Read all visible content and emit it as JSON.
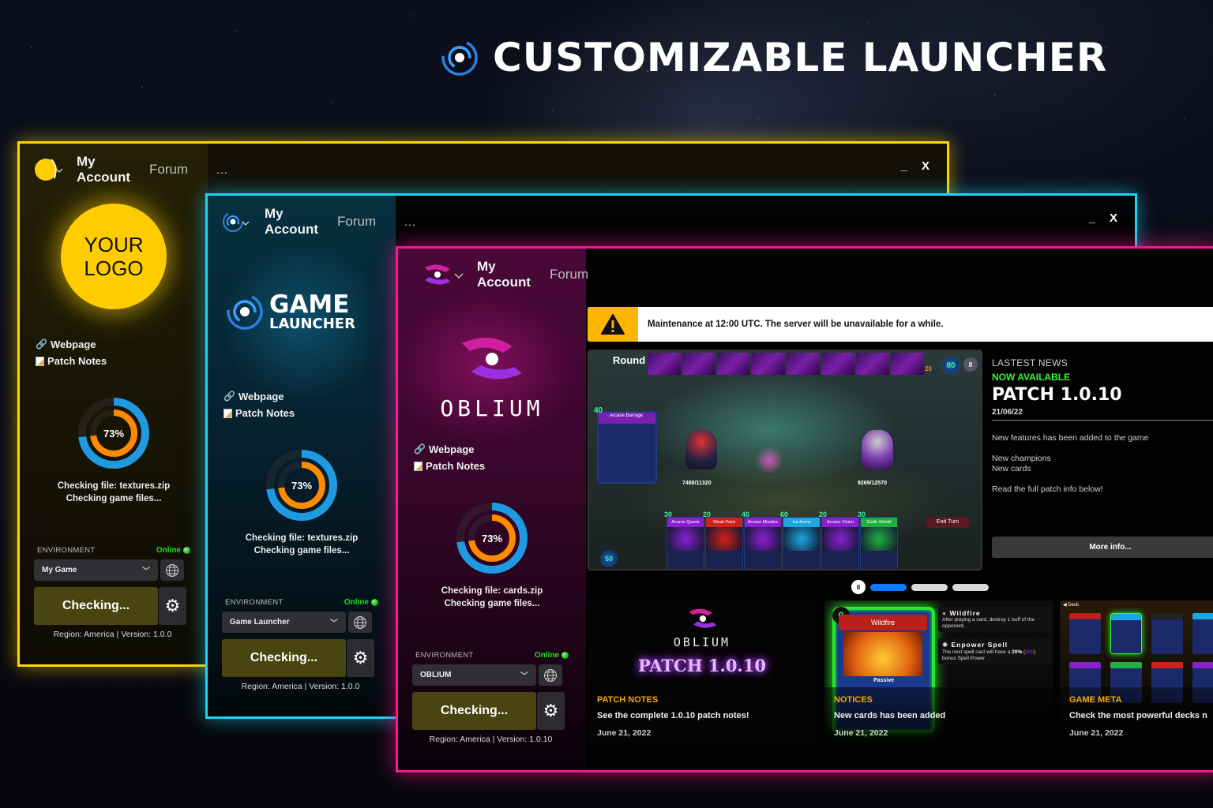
{
  "headline": {
    "title": "CUSTOMIZABLE LAUNCHER",
    "icon": "launcher-ring-icon"
  },
  "windows": [
    {
      "theme": "yellow",
      "accent": "#ffd400",
      "nav": {
        "account": "My Account",
        "forum": "Forum",
        "more": "..."
      },
      "controls": {
        "minimize": "_",
        "close": "X"
      },
      "brand": {
        "line1": "YOUR",
        "line2": "LOGO"
      },
      "links": {
        "webpage": "Webpage",
        "patch_notes": "Patch Notes"
      },
      "progress": {
        "percent": 73,
        "label": "73%"
      },
      "status": {
        "file": "Checking file: textures.zip",
        "action": "Checking game files..."
      },
      "environment": {
        "label": "ENVIRONMENT",
        "status": "Online",
        "selected": "My Game"
      },
      "action_button": "Checking...",
      "footer": "Region: America | Version: 1.0.0"
    },
    {
      "theme": "blue",
      "accent": "#1ed4f5",
      "nav": {
        "account": "My Account",
        "forum": "Forum",
        "more": "..."
      },
      "controls": {
        "minimize": "_",
        "close": "X"
      },
      "brand": {
        "line1": "GAME",
        "line2": "LAUNCHER"
      },
      "links": {
        "webpage": "Webpage",
        "patch_notes": "Patch Notes"
      },
      "progress": {
        "percent": 73,
        "label": "73%"
      },
      "status": {
        "file": "Checking file: textures.zip",
        "action": "Checking game files..."
      },
      "environment": {
        "label": "ENVIRONMENT",
        "status": "Online",
        "selected": "Game Launcher"
      },
      "action_button": "Checking...",
      "footer": "Region: America | Version: 1.0.0"
    },
    {
      "theme": "pink",
      "accent": "#ff1493",
      "nav": {
        "account": "My Account",
        "forum": "Forum"
      },
      "brand": {
        "line1": "OBLIUM"
      },
      "links": {
        "webpage": "Webpage",
        "patch_notes": "Patch Notes"
      },
      "progress": {
        "percent": 73,
        "label": "73%"
      },
      "status": {
        "file": "Checking file: cards.zip",
        "action": "Checking game files..."
      },
      "environment": {
        "label": "ENVIRONMENT",
        "status": "Online",
        "selected": "OBLIUM"
      },
      "action_button": "Checking...",
      "footer": "Region: America | Version: 1.0.10",
      "alert": {
        "icon": "warning-icon",
        "text": "Maintenance at 12:00 UTC. The server will be unavailable for a while."
      },
      "gameplay": {
        "round": "Round 9",
        "mana_top": "80",
        "deck_count": "20",
        "mana_bottom": "50",
        "hp_left": "7488/11320",
        "hp_right": "9269/12570",
        "end_turn": "End Turn",
        "played_card": {
          "cost": "40",
          "name": "Arcane Barrage"
        },
        "hand": [
          {
            "cost": "30",
            "name": "Arcane Quartz",
            "color": "#8a1fd0"
          },
          {
            "cost": "20",
            "name": "Weak Point",
            "color": "#d0201a"
          },
          {
            "cost": "40",
            "name": "Arcane Missiles",
            "color": "#8a1fd0"
          },
          {
            "cost": "60",
            "name": "Ice Arrow",
            "color": "#1aa8e0"
          },
          {
            "cost": "20",
            "name": "Arcane Vision",
            "color": "#8a1fd0"
          },
          {
            "cost": "30",
            "name": "Earth Shield",
            "color": "#1fb040"
          }
        ]
      },
      "news": {
        "kicker": "LASTEST NEWS",
        "availability": "NOW AVAILABLE",
        "title": "PATCH 1.0.10",
        "date": "21/06/22",
        "body": [
          "New features has been added to the game",
          "New champions",
          "New cards",
          "Read the full patch info below!"
        ],
        "more_button": "More info..."
      },
      "carousel": {
        "slides": 3,
        "active": 0
      },
      "tiles": [
        {
          "category": "PATCH NOTES",
          "description": "See the complete 1.0.10 patch notes!",
          "date": "June 21, 2022",
          "art_title": "OBLIUM",
          "art_subtitle": "PATCH 1.0.10"
        },
        {
          "category": "NOTICES",
          "description": "New cards has been added",
          "date": "June 21, 2022",
          "card": {
            "cost": "0",
            "name": "Wildfire",
            "type": "Passive"
          },
          "tooltips": [
            {
              "title": "Wildfire",
              "body": "After playing a card, destroy 1 buff of the opponent."
            },
            {
              "title": "Enpower Spell",
              "body_pre": "The next spell cast will have a ",
              "bold": "20%",
              "mid": " (",
              "highlight": "200",
              "post": ") bonus Spell Power"
            }
          ]
        },
        {
          "category": "GAME META",
          "description": "Check the most powerful decks n",
          "date": "June 21, 2022",
          "deck_label": "Deck"
        }
      ]
    }
  ]
}
